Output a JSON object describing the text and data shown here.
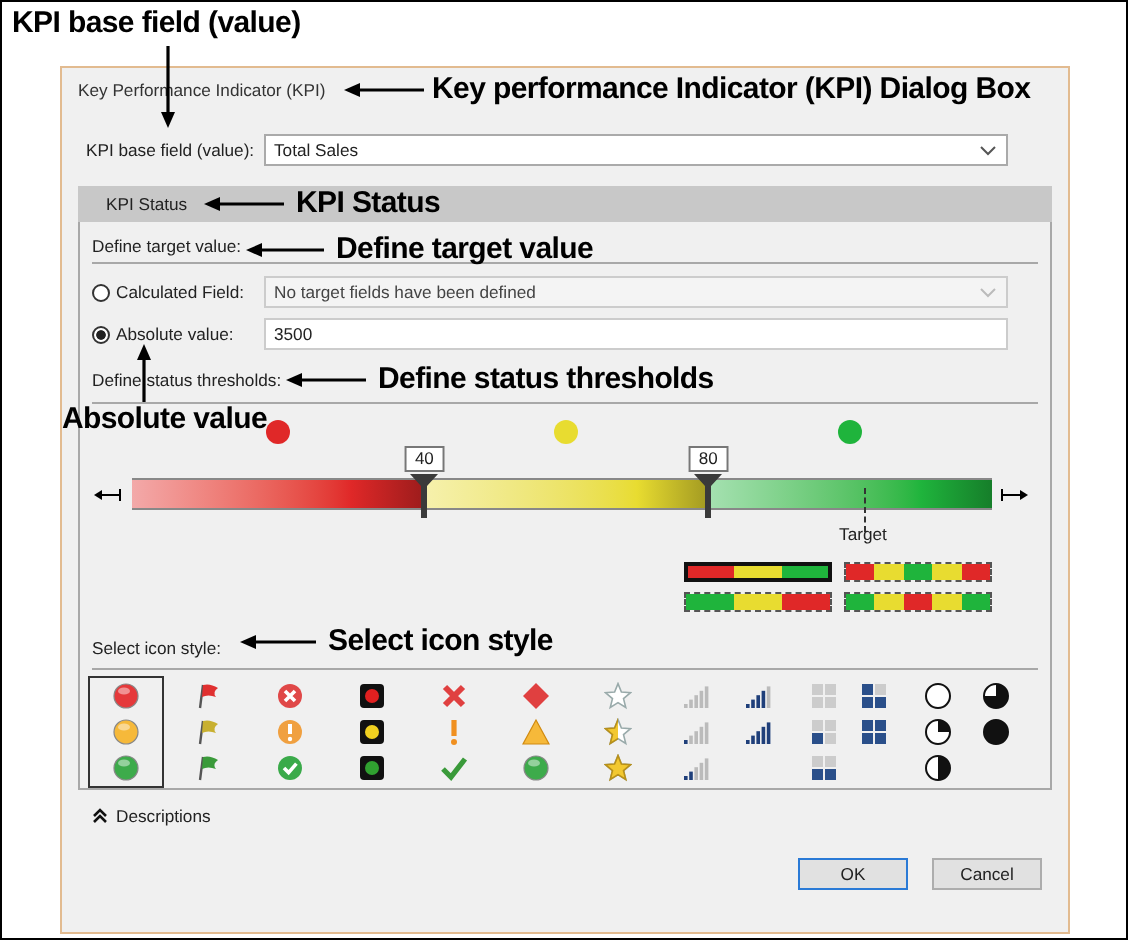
{
  "dialog": {
    "title": "Key Performance Indicator (KPI)",
    "base_field": {
      "label": "KPI base field (value):",
      "value": "Total Sales"
    },
    "section": {
      "title": "KPI Status"
    },
    "target": {
      "heading": "Define target value:",
      "options": [
        {
          "label": "Calculated Field:",
          "selected": false,
          "kind": "dropdown",
          "value": "No target fields have been defined",
          "disabled": true
        },
        {
          "label": "Absolute value:",
          "selected": true,
          "kind": "input",
          "value": "3500",
          "disabled": false
        }
      ]
    },
    "thresholds": {
      "heading": "Define status thresholds:",
      "bands": [
        {
          "color": "#e02828"
        },
        {
          "color": "#e8dc30"
        },
        {
          "color": "#1fb43c"
        }
      ],
      "markers": [
        {
          "label": "40",
          "level": 0.34
        },
        {
          "label": "80",
          "level": 0.67
        }
      ],
      "target": {
        "label": "Target",
        "level": 0.85
      },
      "band_styles": [
        {
          "kind": "low-bad",
          "selected": true
        },
        {
          "kind": "middle-good",
          "selected": false
        },
        {
          "kind": "low-good",
          "selected": false
        },
        {
          "kind": "middle-bad",
          "selected": false
        }
      ]
    },
    "icon_style": {
      "heading": "Select icon style:",
      "styles": [
        {
          "kind": "circles",
          "selected": true
        },
        {
          "kind": "flags",
          "selected": false
        },
        {
          "kind": "circled-symbols",
          "selected": false
        },
        {
          "kind": "lights",
          "selected": false
        },
        {
          "kind": "symbols",
          "selected": false
        },
        {
          "kind": "shapes",
          "selected": false
        },
        {
          "kind": "stars",
          "selected": false
        },
        {
          "kind": "bars",
          "selected": false
        },
        {
          "kind": "boxes",
          "selected": false
        },
        {
          "kind": "pies",
          "selected": false
        }
      ]
    },
    "descriptions": {
      "label": "Descriptions"
    },
    "buttons": [
      {
        "label": "OK",
        "default": true
      },
      {
        "label": "Cancel",
        "default": false
      }
    ]
  },
  "annotations": [
    {
      "kind": "base-field",
      "text": "KPI base field (value)"
    },
    {
      "kind": "dialog-box",
      "text": "Key performance Indicator (KPI) Dialog Box"
    },
    {
      "kind": "kpi-status",
      "text": "KPI Status"
    },
    {
      "kind": "target-value",
      "text": "Define target value"
    },
    {
      "kind": "status-thresholds",
      "text": "Define status thresholds"
    },
    {
      "kind": "absolute-value",
      "text": "Absolute value"
    },
    {
      "kind": "icon-style",
      "text": "Select icon style"
    }
  ]
}
